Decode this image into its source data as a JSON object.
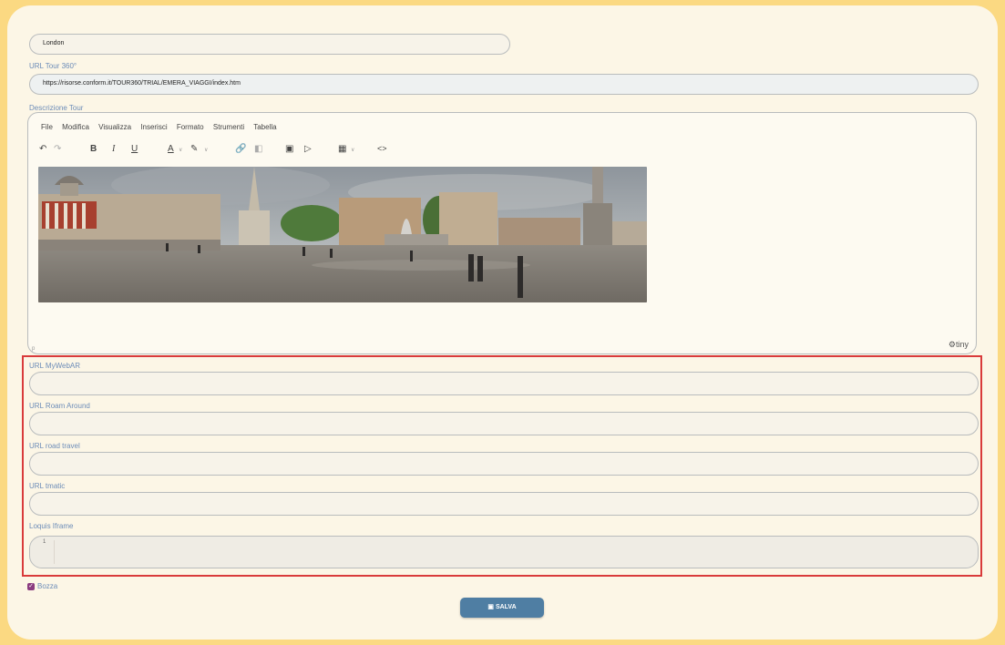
{
  "city": {
    "value": "London"
  },
  "tour": {
    "label": "URL Tour 360°",
    "value": "https://risorse.conform.it/TOUR360/TRIAL/EMERA_VIAGGI/index.htm"
  },
  "editor": {
    "label": "Descrizione Tour",
    "menu": [
      "File",
      "Modifica",
      "Visualizza",
      "Inserisci",
      "Formato",
      "Strumenti",
      "Tabella"
    ],
    "path": "p",
    "brand": "tiny"
  },
  "fields": [
    {
      "label": "URL MyWebAR",
      "value": ""
    },
    {
      "label": "URL Roam Around",
      "value": ""
    },
    {
      "label": "URL road travel",
      "value": ""
    },
    {
      "label": "URL tmatic",
      "value": ""
    }
  ],
  "iframe": {
    "label": "Loquis Iframe",
    "line_number": "1"
  },
  "draft": {
    "label": "Bozza",
    "checked": true
  },
  "save": {
    "label": "SALVA"
  },
  "colors": {
    "page_bg": "#fbd982",
    "card_bg": "#fcf6e6",
    "highlight": "#d93b3b",
    "button": "#4f7ea3",
    "label": "#6c8cb8"
  }
}
